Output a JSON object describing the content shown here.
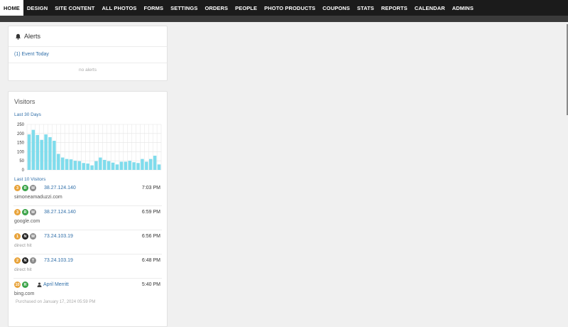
{
  "nav": {
    "items": [
      "HOME",
      "DESIGN",
      "SITE CONTENT",
      "ALL PHOTOS",
      "FORMS",
      "SETTINGS",
      "ORDERS",
      "PEOPLE",
      "PHOTO PRODUCTS",
      "COUPONS",
      "STATS",
      "REPORTS",
      "CALENDAR",
      "ADMINS"
    ],
    "active": "HOME"
  },
  "alerts": {
    "title": "Alerts",
    "event_link": "(1) Event Today",
    "empty": "no alerts"
  },
  "visitors": {
    "title": "Visitors",
    "range_label": "Last 30 Days",
    "recent_label": "Last 10 Visitors",
    "rows": [
      {
        "badges": [
          {
            "t": "3",
            "c": "orange"
          },
          {
            "t": "R",
            "c": "green"
          },
          {
            "t": "M",
            "c": "gray"
          }
        ],
        "ip": "38.27.124.140",
        "time": "7:03 PM",
        "source": "simoneamaduzzi.com",
        "muted": false
      },
      {
        "badges": [
          {
            "t": "3",
            "c": "orange"
          },
          {
            "t": "R",
            "c": "green"
          },
          {
            "t": "M",
            "c": "gray"
          }
        ],
        "ip": "38.27.124.140",
        "time": "6:59 PM",
        "source": "google.com",
        "muted": false
      },
      {
        "badges": [
          {
            "t": "1",
            "c": "orange"
          },
          {
            "t": "N",
            "c": "black"
          },
          {
            "t": "M",
            "c": "gray"
          }
        ],
        "ip": "73.24.103.19",
        "time": "6:56 PM",
        "source": "direct hit",
        "muted": true
      },
      {
        "badges": [
          {
            "t": "2",
            "c": "orange"
          },
          {
            "t": "N",
            "c": "black"
          },
          {
            "t": "T",
            "c": "gray"
          }
        ],
        "ip": "73.24.103.19",
        "time": "6:48 PM",
        "source": "direct hit",
        "muted": true
      },
      {
        "badges": [
          {
            "t": "10",
            "c": "orange"
          },
          {
            "t": "R",
            "c": "green"
          }
        ],
        "user": "April Merritt",
        "time": "5:40 PM",
        "source": "bing.com",
        "muted": false,
        "note": "Purchased on January 17, 2024 05:59 PM"
      }
    ]
  },
  "colors": {
    "bar": "#7fdcec",
    "grid": "#e4e4e4",
    "link": "#2f6ea8",
    "nav_bg": "#1b1b1b"
  },
  "chart_data": {
    "type": "bar",
    "title": "",
    "xlabel": "",
    "ylabel": "",
    "ylim": [
      0,
      250
    ],
    "yticks": [
      0,
      50,
      100,
      150,
      200,
      250
    ],
    "grid": true,
    "values": [
      195,
      220,
      192,
      165,
      195,
      180,
      160,
      88,
      68,
      60,
      58,
      50,
      48,
      38,
      35,
      25,
      48,
      68,
      55,
      48,
      40,
      30,
      45,
      45,
      50,
      42,
      38,
      60,
      45,
      60,
      78,
      30
    ]
  }
}
